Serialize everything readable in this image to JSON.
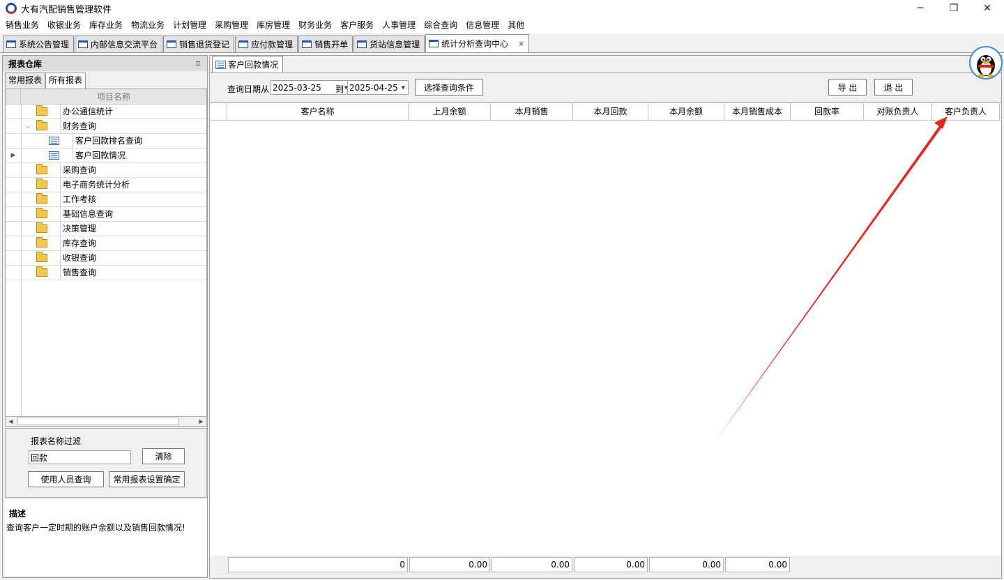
{
  "window": {
    "title": "大有汽配销售管理软件",
    "minimize": "─",
    "restore": "❐",
    "close": "✕"
  },
  "menu": [
    "销售业务",
    "收银业务",
    "库存业务",
    "物流业务",
    "计划管理",
    "采购管理",
    "库房管理",
    "财务业务",
    "客户服务",
    "人事管理",
    "综合查询",
    "信息管理",
    "其他"
  ],
  "doc_tabs": [
    {
      "label": "系统公告管理",
      "active": false
    },
    {
      "label": "内部信息交流平台",
      "active": false
    },
    {
      "label": "销售退货登记",
      "active": false
    },
    {
      "label": "应付款管理",
      "active": false
    },
    {
      "label": "销售开单",
      "active": false
    },
    {
      "label": "货站信息管理",
      "active": false
    },
    {
      "label": "统计分析查询中心",
      "active": true
    }
  ],
  "tab_close": "×",
  "left_panel": {
    "title": "报表仓库",
    "pin": "ㅍ",
    "tabs": [
      "常用报表",
      "所有报表"
    ],
    "tree_header": "项目名称",
    "tree": [
      {
        "label": "办公通信统计",
        "type": "folder",
        "level": 0,
        "expander": ""
      },
      {
        "label": "财务查询",
        "type": "folder",
        "level": 0,
        "expander": "⌵"
      },
      {
        "label": "客户回款排名查询",
        "type": "report",
        "level": 1,
        "expander": ""
      },
      {
        "label": "客户回款情况",
        "type": "report",
        "level": 1,
        "expander": "",
        "current": true
      },
      {
        "label": "采购查询",
        "type": "folder",
        "level": 0,
        "expander": ""
      },
      {
        "label": "电子商务统计分析",
        "type": "folder",
        "level": 0,
        "expander": ""
      },
      {
        "label": "工作考核",
        "type": "folder",
        "level": 0,
        "expander": ""
      },
      {
        "label": "基础信息查询",
        "type": "folder",
        "level": 0,
        "expander": ""
      },
      {
        "label": "决策管理",
        "type": "folder",
        "level": 0,
        "expander": ""
      },
      {
        "label": "库存查询",
        "type": "folder",
        "level": 0,
        "expander": ""
      },
      {
        "label": "收银查询",
        "type": "folder",
        "level": 0,
        "expander": ""
      },
      {
        "label": "销售查询",
        "type": "folder",
        "level": 0,
        "expander": ""
      }
    ],
    "filter_label": "报表名称过滤",
    "filter_value": "回款",
    "clear_label": "清除",
    "users_query_label": "使用人员查询",
    "common_report_confirm_label": "常用报表设置确定",
    "desc_title": "描述",
    "desc_text": "查询客户一定时期的账户余额以及销售回款情况!"
  },
  "main": {
    "subtab": "客户回款情况",
    "date_from_label": "查询日期从",
    "date_from": "2025-03-25",
    "to_label": "到",
    "date_to": "2025-04-25",
    "select_cond_label": "选择查询条件",
    "export_label": "导 出",
    "exit_label": "退 出",
    "columns": [
      "客户名称",
      "上月余额",
      "本月销售",
      "本月回款",
      "本月余额",
      "本月销售成本",
      "回款率",
      "对账负责人",
      "客户负责人"
    ],
    "footer": [
      "0",
      "0.00",
      "0.00",
      "0.00",
      "0.00",
      "0.00"
    ]
  },
  "colors": {
    "arrow": "#e8241d",
    "accent": "#1c57a8"
  }
}
